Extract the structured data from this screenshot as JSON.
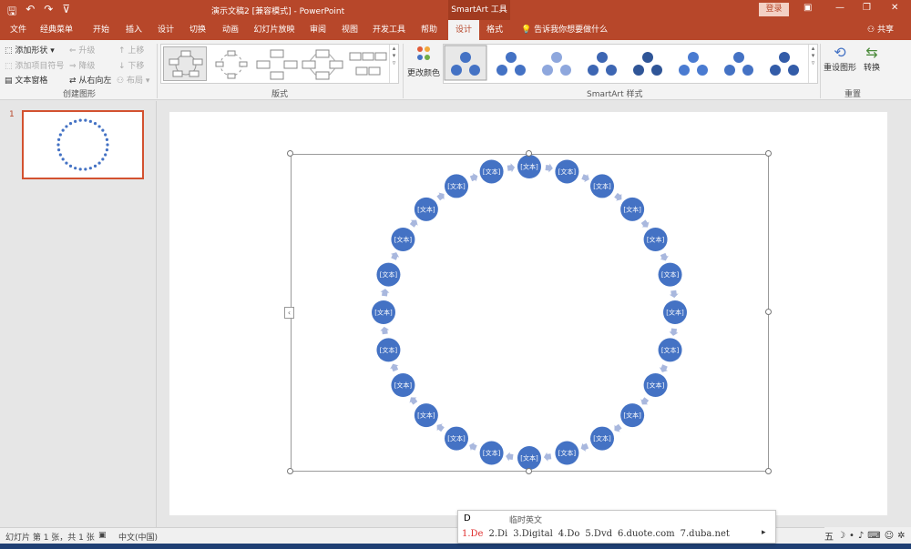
{
  "titlebar": {
    "doc_title": "演示文稿2 [兼容模式] - PowerPoint",
    "context_tools": "SmartArt 工具",
    "login": "登录",
    "qat_save": "🖫",
    "qat_undo": "↶",
    "qat_redo": "↷",
    "qat_custom": "⊽"
  },
  "tabs": {
    "file": "文件",
    "classic": "经典菜单",
    "home": "开始",
    "insert": "插入",
    "design": "设计",
    "transitions": "切换",
    "animations": "动画",
    "slideshow": "幻灯片放映",
    "review": "审阅",
    "view": "视图",
    "developer": "开发工具",
    "help": "帮助",
    "sa_design": "设计",
    "sa_format": "格式",
    "tellme": "告诉我你想要做什么",
    "share": "共享"
  },
  "ribbon": {
    "create_graphic": {
      "add_shape": "添加形状",
      "add_bullet": "添加项目符号",
      "text_pane": "文本窗格",
      "promote": "升级",
      "demote": "降级",
      "rtl": "从右向左",
      "move_up": "上移",
      "move_down": "下移",
      "layout": "布局",
      "label": "创建图形"
    },
    "layouts": {
      "label": "版式"
    },
    "styles": {
      "change_colors": "更改颜色",
      "label": "SmartArt 样式"
    },
    "reset": {
      "reset_graphic": "重设图形",
      "convert": "转换",
      "label": "重置"
    }
  },
  "thumbs": {
    "slide_number": "1"
  },
  "smartart": {
    "node_text": "[文本]",
    "node_count": 24,
    "node_color": "#4472c4",
    "arrow_color": "#a9b8de"
  },
  "ime": {
    "input": "D",
    "temp_english": "临时英文",
    "candidates": [
      "1.De",
      "2.Di",
      "3.Digital",
      "4.Do",
      "5.Dvd",
      "6.duote.com",
      "7.duba.net"
    ],
    "next": "▸"
  },
  "statusbar": {
    "slide_info": "幻灯片 第 1 张，共 1 张",
    "language": "中文(中国)"
  },
  "tray": {
    "ime_label": "五",
    "moon": "☽",
    "dot": "•",
    "wave": "♪",
    "keyboard": "⌨",
    "user": "☺",
    "settings": "✲"
  },
  "colors": {
    "accent": "#b7472a",
    "node": "#4472c4"
  }
}
